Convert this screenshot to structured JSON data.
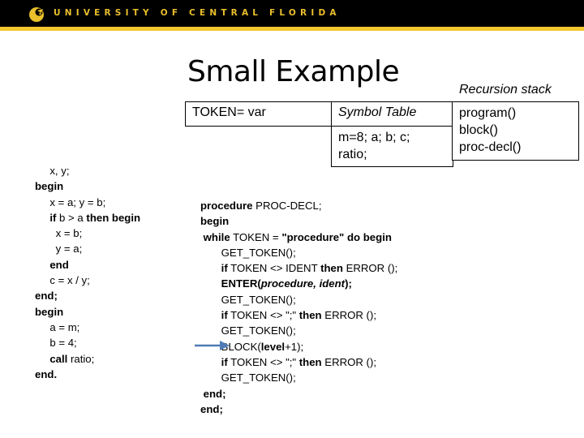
{
  "header": {
    "university_name": "UNIVERSITY OF CENTRAL FLORIDA",
    "logo_icon": "pegasus-logo-icon",
    "colors": {
      "background": "#000000",
      "accent": "#f2c82e",
      "text": "#e9bf2c"
    }
  },
  "slide": {
    "title": "Small Example",
    "token_label": "TOKEN= var",
    "symbol_table": {
      "header": "Symbol Table",
      "entries_line1": "m=8; a; b; c;",
      "entries_line2": "ratio;"
    },
    "recursion_stack": {
      "label": "Recursion stack",
      "items": [
        "program()",
        "block()",
        "proc-decl()"
      ]
    },
    "source_code": [
      {
        "indent": "     ",
        "parts": [
          {
            "t": "x, y;",
            "s": ""
          }
        ]
      },
      {
        "indent": "",
        "parts": [
          {
            "t": "begin",
            "s": "b"
          }
        ]
      },
      {
        "indent": "     ",
        "parts": [
          {
            "t": "x = a; y = b;",
            "s": ""
          }
        ]
      },
      {
        "indent": "     ",
        "parts": [
          {
            "t": "if",
            "s": "b"
          },
          {
            "t": " b > a ",
            "s": ""
          },
          {
            "t": "then begin",
            "s": "b"
          }
        ]
      },
      {
        "indent": "       ",
        "parts": [
          {
            "t": "x = b;",
            "s": ""
          }
        ]
      },
      {
        "indent": "       ",
        "parts": [
          {
            "t": "y = a;",
            "s": ""
          }
        ]
      },
      {
        "indent": "     ",
        "parts": [
          {
            "t": "end",
            "s": "b"
          }
        ]
      },
      {
        "indent": "     ",
        "parts": [
          {
            "t": "c = x / y;",
            "s": ""
          }
        ]
      },
      {
        "indent": "",
        "parts": [
          {
            "t": "end;",
            "s": "b"
          }
        ]
      },
      {
        "indent": "",
        "parts": [
          {
            "t": "begin",
            "s": "b"
          }
        ]
      },
      {
        "indent": "     ",
        "parts": [
          {
            "t": "a = m;",
            "s": ""
          }
        ]
      },
      {
        "indent": "     ",
        "parts": [
          {
            "t": "b = 4;",
            "s": ""
          }
        ]
      },
      {
        "indent": "     ",
        "parts": [
          {
            "t": "call",
            "s": "b"
          },
          {
            "t": " ratio;",
            "s": ""
          }
        ]
      },
      {
        "indent": "",
        "parts": [
          {
            "t": "end.",
            "s": "b"
          }
        ]
      }
    ],
    "parser_code": [
      {
        "indent": "",
        "parts": [
          {
            "t": "procedure",
            "s": "b"
          },
          {
            "t": " PROC-DECL;",
            "s": ""
          }
        ]
      },
      {
        "indent": "",
        "parts": [
          {
            "t": "begin",
            "s": "b"
          }
        ]
      },
      {
        "indent": " ",
        "parts": [
          {
            "t": "while",
            "s": "b"
          },
          {
            "t": " TOKEN = ",
            "s": ""
          },
          {
            "t": "\"procedure\" do begin",
            "s": "b"
          }
        ]
      },
      {
        "indent": "       ",
        "parts": [
          {
            "t": "GET_TOKEN();",
            "s": ""
          }
        ]
      },
      {
        "indent": "       ",
        "parts": [
          {
            "t": "if",
            "s": "b"
          },
          {
            "t": " TOKEN <> IDENT ",
            "s": ""
          },
          {
            "t": "then",
            "s": "b"
          },
          {
            "t": " ERROR ();",
            "s": ""
          }
        ]
      },
      {
        "indent": "       ",
        "parts": [
          {
            "t": "ENTER(",
            "s": "b"
          },
          {
            "t": "procedure, ident",
            "s": "bi"
          },
          {
            "t": ");",
            "s": "b"
          }
        ]
      },
      {
        "indent": "       ",
        "parts": [
          {
            "t": "GET_TOKEN();",
            "s": ""
          }
        ]
      },
      {
        "indent": "       ",
        "parts": [
          {
            "t": "if",
            "s": "b"
          },
          {
            "t": " TOKEN <> \";\" ",
            "s": ""
          },
          {
            "t": "then",
            "s": "b"
          },
          {
            "t": " ERROR ();",
            "s": ""
          }
        ]
      },
      {
        "indent": "       ",
        "parts": [
          {
            "t": "GET_TOKEN();",
            "s": ""
          }
        ]
      },
      {
        "indent": "       ",
        "parts": [
          {
            "t": "BLOCK(",
            "s": ""
          },
          {
            "t": "level",
            "s": "b"
          },
          {
            "t": "+1);",
            "s": ""
          }
        ]
      },
      {
        "indent": "       ",
        "parts": [
          {
            "t": "if",
            "s": "b"
          },
          {
            "t": " TOKEN <> \";\" ",
            "s": ""
          },
          {
            "t": "then",
            "s": "b"
          },
          {
            "t": " ERROR ();",
            "s": ""
          }
        ]
      },
      {
        "indent": "       ",
        "parts": [
          {
            "t": "GET_TOKEN();",
            "s": ""
          }
        ]
      },
      {
        "indent": " ",
        "parts": [
          {
            "t": "end;",
            "s": "b"
          }
        ]
      },
      {
        "indent": "",
        "parts": [
          {
            "t": "end;",
            "s": "b"
          }
        ]
      }
    ],
    "current_line_arrow": {
      "icon": "right-arrow-icon",
      "points_to_line": "BLOCK(level+1);",
      "color": "#4f7cb6"
    }
  }
}
